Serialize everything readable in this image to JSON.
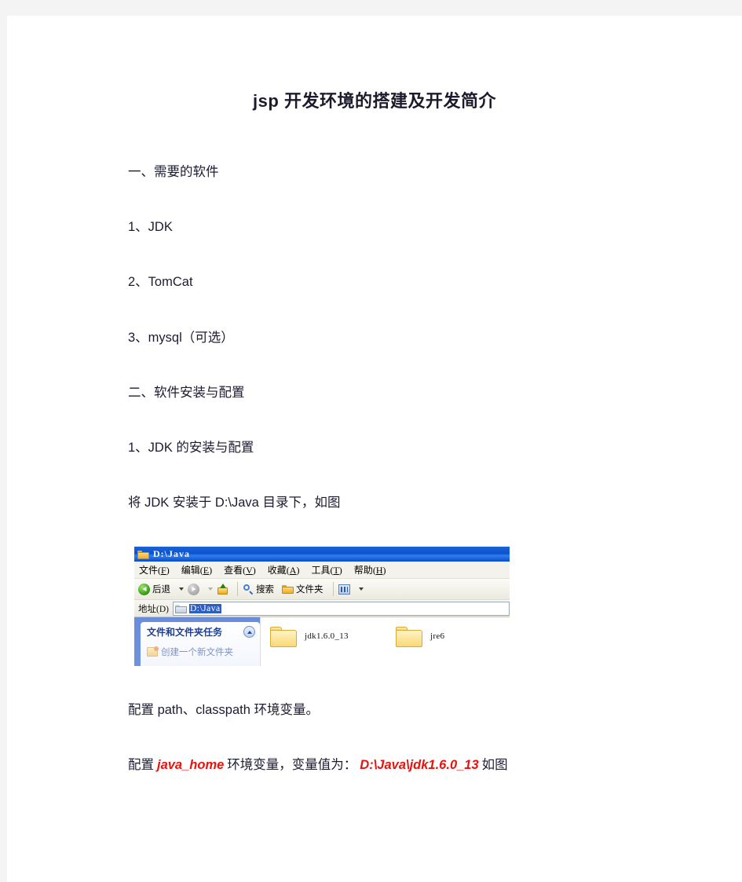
{
  "document": {
    "title": "jsp 开发环境的搭建及开发简介",
    "paragraphs": [
      {
        "id": "p1",
        "text": "一、需要的软件"
      },
      {
        "id": "p2",
        "text": "1、JDK"
      },
      {
        "id": "p3",
        "text": "2、TomCat"
      },
      {
        "id": "p4",
        "text": "3、mysql（可选）"
      },
      {
        "id": "p5",
        "text": "二、软件安装与配置"
      },
      {
        "id": "p6",
        "text": "1、JDK 的安装与配置"
      },
      {
        "id": "p7",
        "text": "将 JDK 安装于 D:\\Java 目录下，如图"
      },
      {
        "id": "p8",
        "text": "配置 path、classpath 环境变量。"
      }
    ],
    "last_paragraph": {
      "prefix": "配置",
      "emphasis1": "java_home",
      "middle": "环境变量，变量值为：",
      "emphasis2": "D:\\Java\\jdk1.6.0_13",
      "suffix": "如图",
      "emphasis_color": "#e8120e"
    }
  },
  "explorer": {
    "titlebar": {
      "text": "D:\\Java",
      "icon": "folder-icon"
    },
    "menus": [
      {
        "label": "文件",
        "accel": "F"
      },
      {
        "label": "编辑",
        "accel": "E"
      },
      {
        "label": "查看",
        "accel": "V"
      },
      {
        "label": "收藏",
        "accel": "A"
      },
      {
        "label": "工具",
        "accel": "T"
      },
      {
        "label": "帮助",
        "accel": "H"
      }
    ],
    "toolbar": {
      "back_label": "后退",
      "search_label": "搜索",
      "folders_label": "文件夹",
      "views_label": ""
    },
    "address": {
      "label": "地址(D)",
      "value": "D:\\Java"
    },
    "sidepane": {
      "task_title": "文件和文件夹任务",
      "task_link": "创建一个新文件夹"
    },
    "files": [
      {
        "name": "jdk1.6.0_13",
        "type": "folder"
      },
      {
        "name": "jre6",
        "type": "folder"
      }
    ]
  }
}
